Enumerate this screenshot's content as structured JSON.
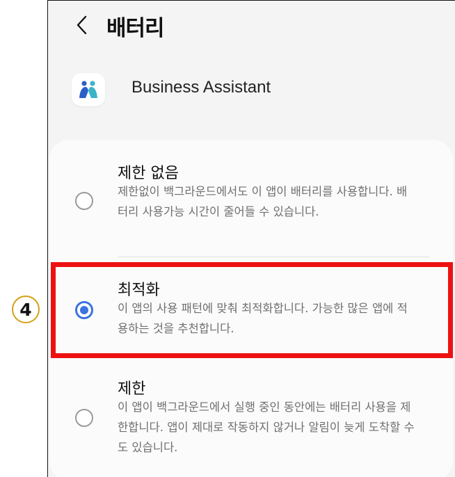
{
  "header": {
    "title": "배터리",
    "back_icon": "chevron-left-icon"
  },
  "app": {
    "name": "Business Assistant",
    "icon": "business-assistant-app-icon"
  },
  "options": [
    {
      "title": "제한 없음",
      "description": "제한없이 백그라운드에서도 이 앱이 배터리를 사용합니다. 배터리 사용가능 시간이 줄어들 수 있습니다.",
      "selected": false
    },
    {
      "title": "최적화",
      "description": "이 앱의 사용 패턴에 맞춰 최적화합니다. 가능한 많은 앱에 적용하는 것을 추천합니다.",
      "selected": true
    },
    {
      "title": "제한",
      "description": "이 앱이 백그라운드에서 실행 중인 동안에는 배터리 사용을 제한합니다. 앱이 제대로 작동하지 않거나 알림이 늦게 도착할 수도 있습니다.",
      "selected": false
    }
  ],
  "annotation": {
    "step_number": "4",
    "highlight_color": "#ee1111"
  },
  "colors": {
    "accent": "#3b73e0",
    "background": "#f4f4f4",
    "card": "#fbfbfb"
  }
}
